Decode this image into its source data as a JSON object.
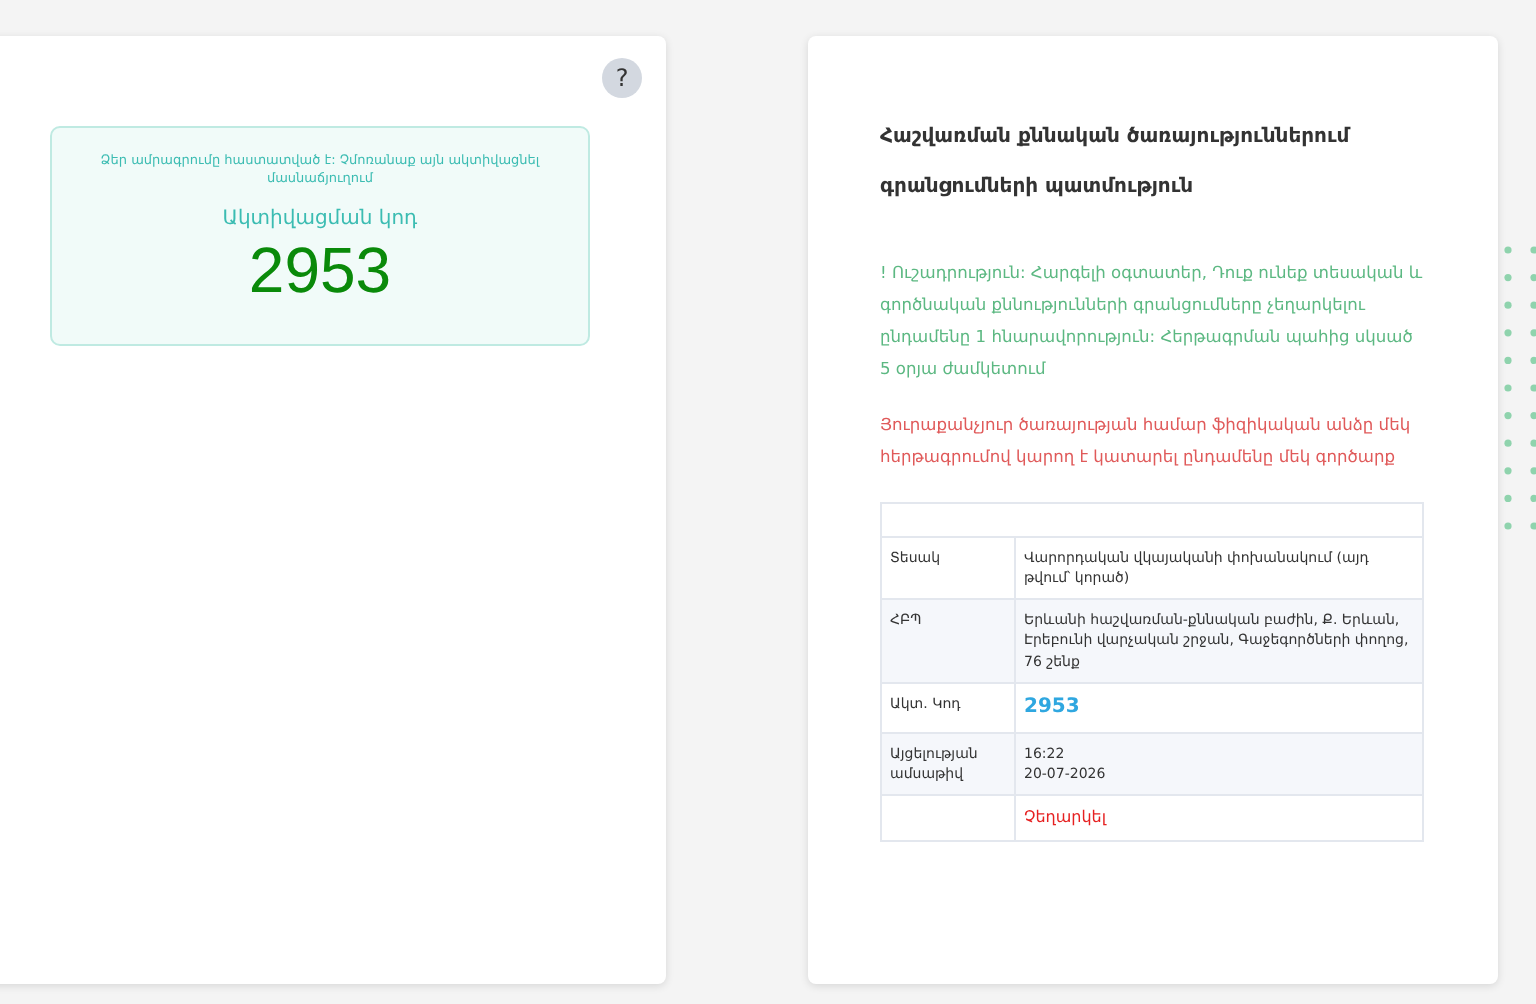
{
  "confirmation": {
    "message": "Ձեր ամրագրումը հաստատված է: Չմոռանաք այն ակտիվացնել մասնաճյուղում",
    "code_label": "Ակտիվացման կոդ",
    "code": "2953",
    "help_button": "?"
  },
  "history": {
    "title": "Հաշվառման քննական ծառայություններում գրանցումների պատմություն",
    "notice": "! Ուշադրություն: Հարգելի օգտատեր, Դուք ունեք տեսական և գործնական քննությունների գրանցումները չեղարկելու ընդամենը 1 հնարավորություն: Հերթագրման պահից սկսած 5 օրյա ժամկետում",
    "warning": "Յուրաքանչյուր ծառայության համար ֆիզիկական անձը մեկ հերթագրումով կարող է կատարել ընդամենը մեկ գործարք",
    "rows": [
      {
        "kind": "text",
        "label": "Տեսակ",
        "value": "Վարորդական վկայականի փոխանակում (այդ թվում՝ կորած)"
      },
      {
        "kind": "text",
        "label": "ՀԲՊ",
        "value": "Երևանի հաշվառման-քննական բաժին, Ք. Երևան, Էրեբունի վարչական շրջան, Գաջեգործների փողոց, 76 շենք"
      },
      {
        "kind": "code",
        "label": "Ակտ. Կոդ",
        "value": "2953"
      },
      {
        "kind": "text",
        "label": "Այցելության ամսաթիվ",
        "value": "16:22\n20-07-2026"
      },
      {
        "kind": "action",
        "value": "Չեղարկել"
      }
    ]
  }
}
